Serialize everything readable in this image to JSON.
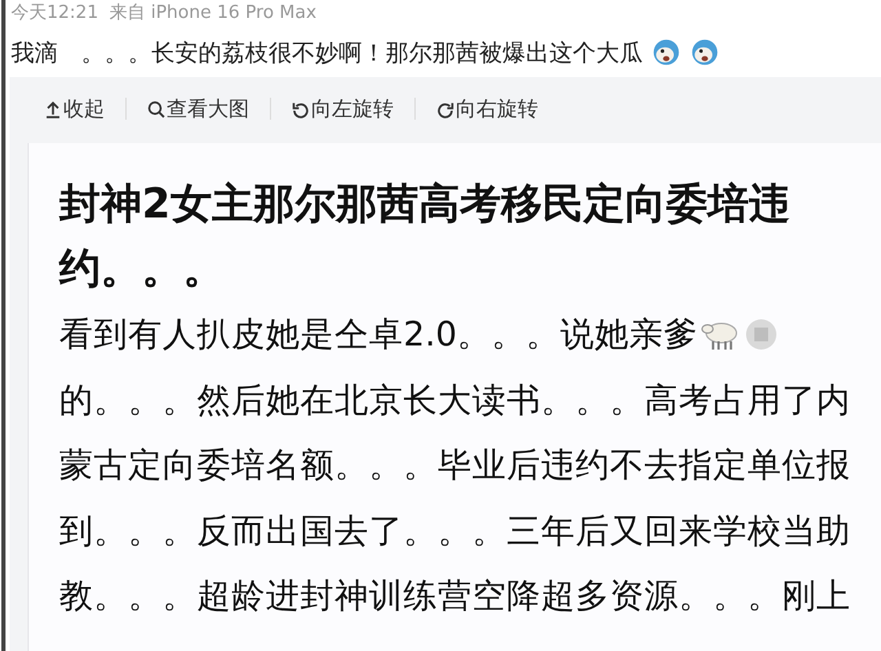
{
  "meta": {
    "time": "今天12:21",
    "source": "来自 iPhone 16 Pro Max"
  },
  "post": {
    "text": "我滴　。。。长安的荔枝很不妙啊！那尔那茜被爆出这个大瓜",
    "trailing_emoji": true
  },
  "toolbar": [
    {
      "label": "收起",
      "kind": "collapse"
    },
    {
      "label": "查看大图",
      "kind": "zoom"
    },
    {
      "label": "向左旋转",
      "kind": "rotate-left"
    },
    {
      "label": "向右旋转",
      "kind": "rotate-right"
    }
  ],
  "article": {
    "title_lines": [
      "封神2女主那尔那茜高考移民定向委培违",
      "约。。。"
    ],
    "body_lines": [
      {
        "text": "看到有人扒皮她是仝卓2.0。。。说她亲爹",
        "trailing_emoji": true
      },
      {
        "text": "的。。。然后她在北京长大读书。。。高考占用了内"
      },
      {
        "text": "蒙古定向委培名额。。。毕业后违约不去指定单位报"
      },
      {
        "text": "到。。。反而出国去了。。。三年后又回来学校当助"
      },
      {
        "text": "教。。。超龄进封神训练营空降超多资源。。。刚上"
      }
    ]
  }
}
